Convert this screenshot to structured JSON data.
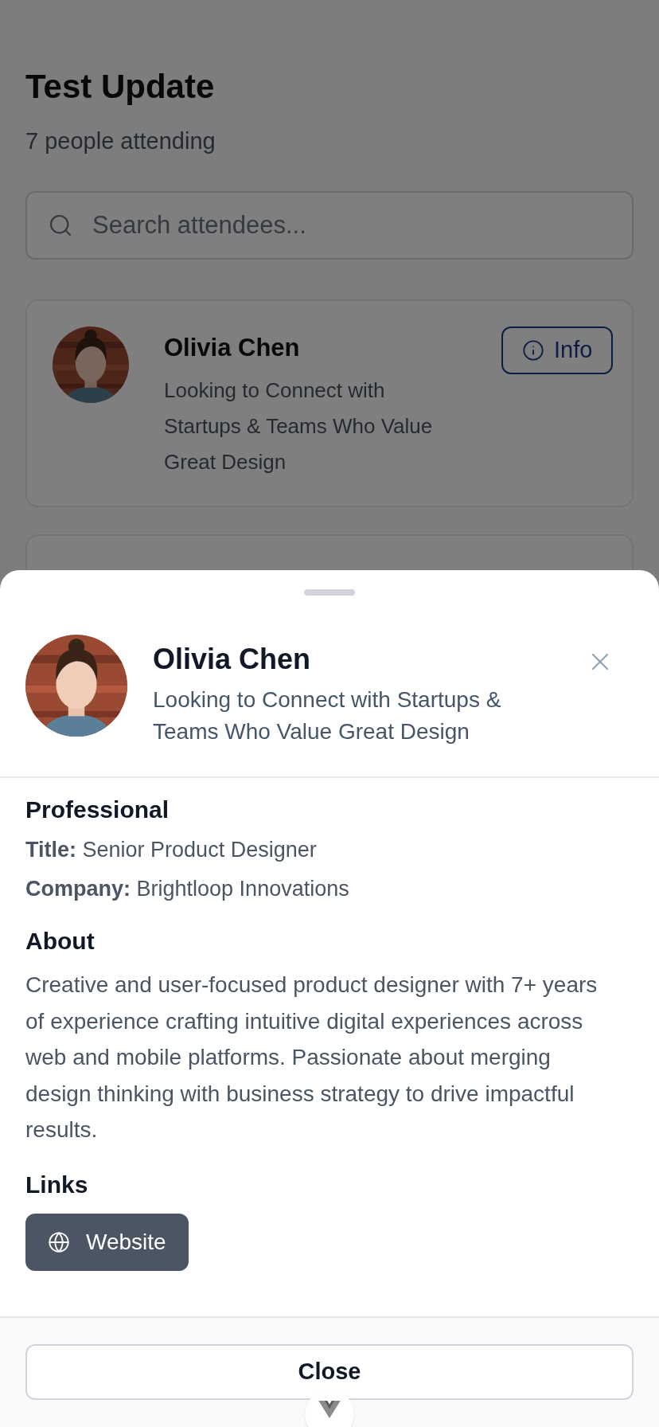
{
  "page": {
    "title": "Test Update",
    "subtitle": "7 people attending",
    "search": {
      "placeholder": "Search attendees..."
    },
    "attendees": [
      {
        "name": "Olivia Chen",
        "headline": "Looking to Connect with Startups & Teams Who Value Great Design",
        "button": "Info"
      }
    ]
  },
  "sheet": {
    "name": "Olivia Chen",
    "headline": "Looking to Connect with Startups & Teams Who Value Great Design",
    "sections": [
      {
        "kind": "fields",
        "heading": "Professional",
        "fields": [
          {
            "label": "Title:",
            "value": "Senior Product Designer"
          },
          {
            "label": "Company:",
            "value": "Brightloop Innovations"
          }
        ]
      },
      {
        "kind": "text",
        "heading": "About",
        "text": "Creative and user-focused product designer with 7+ years of experience crafting intuitive digital experiences across web and mobile platforms. Passionate about merging design thinking with business strategy to drive impactful results."
      },
      {
        "kind": "links",
        "heading": "Links",
        "links": [
          {
            "label": "Website"
          }
        ]
      }
    ],
    "close_button": "Close"
  }
}
